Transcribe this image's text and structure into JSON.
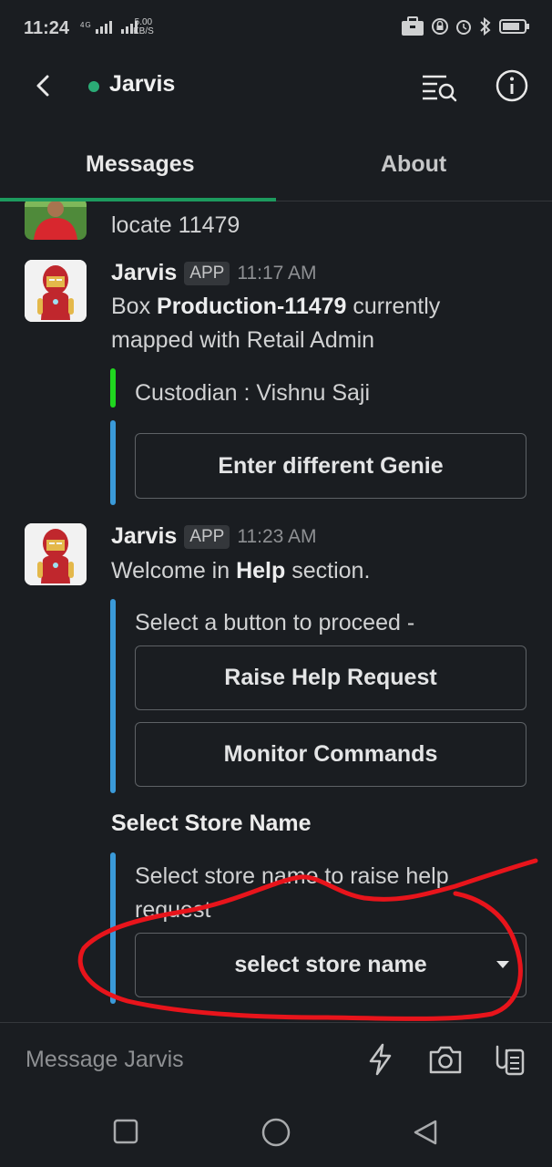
{
  "status_bar": {
    "time": "11:24",
    "network": "4G",
    "net_speed_value": "5.00",
    "net_speed_unit": "KB/S"
  },
  "header": {
    "title": "Jarvis"
  },
  "tabs": [
    {
      "label": "Messages",
      "active": true
    },
    {
      "label": "About",
      "active": false
    }
  ],
  "messages": {
    "previous_text": "locate 11479",
    "msg1": {
      "sender": "Jarvis",
      "badge": "APP",
      "time": "11:17 AM",
      "text_pre": "Box ",
      "text_bold": "Production-11479",
      "text_post": " currently mapped with Retail Admin",
      "custodian": "Custodian : Vishnu Saji",
      "button": "Enter different Genie"
    },
    "msg2": {
      "sender": "Jarvis",
      "badge": "APP",
      "time": "11:23 AM",
      "text_pre": "Welcome in ",
      "text_bold": "Help",
      "text_post": " section.",
      "prompt": "Select a button to proceed -",
      "button1": "Raise Help Request",
      "button2": "Monitor Commands",
      "section_title": "Select Store Name",
      "select_prompt": "Select store name to raise help request",
      "select_value": "select store name"
    }
  },
  "composer": {
    "placeholder": "Message Jarvis"
  },
  "colors": {
    "background": "#1a1d21",
    "presence": "#2bac76",
    "tab_accent": "#1d9a5e",
    "bar_green": "#20d61f",
    "bar_blue": "#3a9ad9",
    "annotation": "#e8141b"
  }
}
